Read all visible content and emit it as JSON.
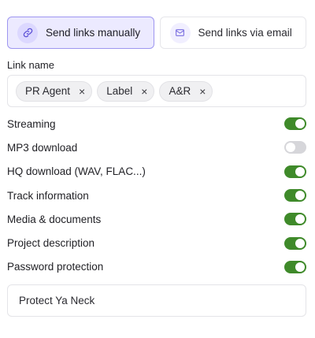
{
  "tabs": [
    {
      "label": "Send links manually",
      "icon": "link-icon",
      "active": true
    },
    {
      "label": "Send links via email",
      "icon": "mail-icon",
      "active": false
    }
  ],
  "link_name": {
    "label": "Link name",
    "chips": [
      "PR Agent",
      "Label",
      "A&R"
    ],
    "remove_symbol": "×"
  },
  "settings": [
    {
      "label": "Streaming",
      "enabled": true
    },
    {
      "label": "MP3 download",
      "enabled": false
    },
    {
      "label": "HQ download (WAV, FLAC...)",
      "enabled": true
    },
    {
      "label": "Track information",
      "enabled": true
    },
    {
      "label": "Media & documents",
      "enabled": true
    },
    {
      "label": "Project description",
      "enabled": true
    },
    {
      "label": "Password protection",
      "enabled": true
    }
  ],
  "password": {
    "value": "Protect Ya Neck"
  },
  "colors": {
    "accent_active_tab": "#eceaff",
    "toggle_on": "#3f8a2a",
    "toggle_off": "#d6d6da"
  }
}
